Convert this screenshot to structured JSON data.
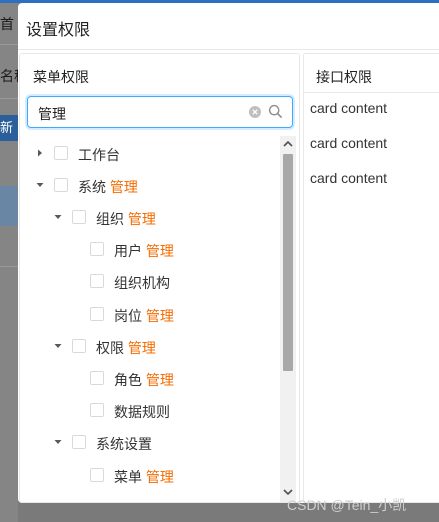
{
  "background": {
    "nav_text": "首",
    "field_label": "名称",
    "button_label": "新"
  },
  "dialog": {
    "title": "设置权限",
    "left_panel": {
      "title": "菜单权限",
      "search": {
        "value": "管理",
        "placeholder": ""
      },
      "tree": [
        {
          "text": "工作台",
          "highlight": "",
          "arrow": "right"
        },
        {
          "text": "系统 ",
          "highlight": "管理",
          "arrow": "down"
        },
        {
          "text": "组织 ",
          "highlight": "管理",
          "arrow": "down"
        },
        {
          "text": "用户 ",
          "highlight": "管理",
          "arrow": ""
        },
        {
          "text": "组织机构",
          "highlight": "",
          "arrow": ""
        },
        {
          "text": "岗位 ",
          "highlight": "管理",
          "arrow": ""
        },
        {
          "text": "权限 ",
          "highlight": "管理",
          "arrow": "down"
        },
        {
          "text": "角色 ",
          "highlight": "管理",
          "arrow": ""
        },
        {
          "text": "数据规则",
          "highlight": "",
          "arrow": ""
        },
        {
          "text": "系统设置",
          "highlight": "",
          "arrow": "down"
        },
        {
          "text": "菜单 ",
          "highlight": "管理",
          "arrow": ""
        }
      ]
    },
    "right_panel": {
      "title": "接口权限",
      "cards": [
        "card content",
        "card content",
        "card content"
      ]
    }
  },
  "watermark": "CSDN @Tein_小凯",
  "colors": {
    "highlight": "#f56c00",
    "accent": "#40a9ff",
    "checkbox_border": "#d9d9d9"
  }
}
